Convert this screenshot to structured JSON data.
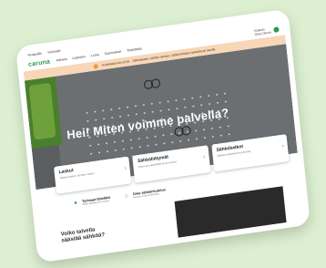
{
  "topbar": {
    "items": [
      "Yksityisille",
      "Yrityksille"
    ]
  },
  "brand": {
    "logo": "caruna"
  },
  "nav": {
    "items": [
      "Palvelu",
      "Laskutus",
      "Luma",
      "Sopimukset",
      "Tiedotteita"
    ]
  },
  "user": {
    "label": "Kirjaudu",
    "sub": "Oma Caruna"
  },
  "banner": {
    "text": "Huoltokatko klo 22.00 – Sähkökatkot, sähkön toimitus, sähkönmittaus hetkellisesti tauolla."
  },
  "hero": {
    "title": "Hei! Miten voimme palvella?"
  },
  "cards": [
    {
      "title": "Laskut",
      "desc": "Tarkista laskusi tai tilaa e-lasku"
    },
    {
      "title": "Sähköliittymät",
      "desc": "Tilaa uusi sähköliittymä tai muutos"
    },
    {
      "title": "Sähkökatkot",
      "desc": "Tarkista katkotilanne ja ilmoita"
    }
  ],
  "links": [
    {
      "title": "Työmaat lähelläsi",
      "sub": "Katso lähialueesi työmaat",
      "icon": "location-pin-icon"
    },
    {
      "title": "Oma sähkönkulutus",
      "sub": "Seuraa omaa kulutustasi",
      "icon": "home-icon"
    }
  ],
  "bottom": {
    "title": "Voiko talvella säästää sähköä?"
  },
  "colors": {
    "brand": "#2f9a45",
    "banner": "#f7d7b8",
    "background": "#dcefd0"
  }
}
